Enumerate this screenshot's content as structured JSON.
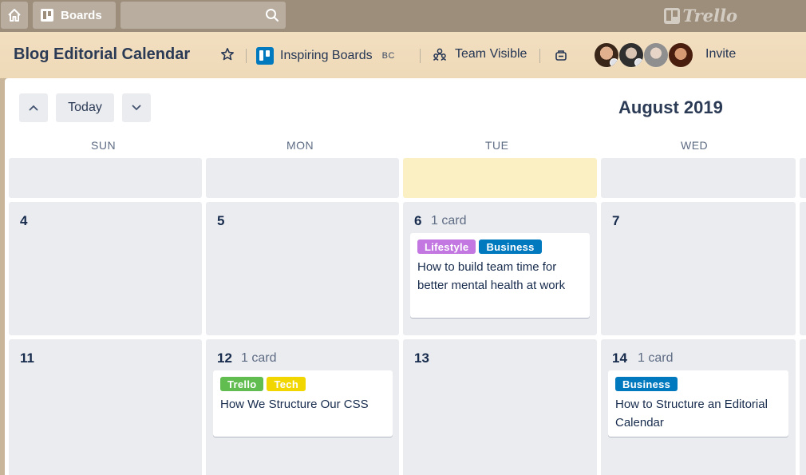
{
  "topbar": {
    "boards_label": "Boards",
    "search_placeholder": "",
    "logo_text": "Trello"
  },
  "board": {
    "title": "Blog Editorial Calendar",
    "team_name": "Inspiring Boards",
    "team_badge": "BC",
    "visibility": "Team Visible",
    "invite_label": "Invite",
    "members": [
      "member-1",
      "member-2",
      "member-3",
      "member-4"
    ]
  },
  "calendar": {
    "today_label": "Today",
    "month_title": "August 2019",
    "weekdays": [
      "SUN",
      "MON",
      "TUE",
      "WED"
    ],
    "rows": [
      {
        "cells": [
          {
            "day": "",
            "count": ""
          },
          {
            "day": "",
            "count": ""
          },
          {
            "day": "",
            "count": "",
            "today": true
          },
          {
            "day": "",
            "count": ""
          }
        ]
      },
      {
        "cells": [
          {
            "day": "4",
            "count": ""
          },
          {
            "day": "5",
            "count": ""
          },
          {
            "day": "6",
            "count": "1 card",
            "card": {
              "labels": [
                {
                  "text": "Lifestyle",
                  "color": "#c377e0"
                },
                {
                  "text": "Business",
                  "color": "#0079bf"
                }
              ],
              "title": "How to build team time for better mental health at work"
            }
          },
          {
            "day": "7",
            "count": ""
          }
        ]
      },
      {
        "cells": [
          {
            "day": "11",
            "count": ""
          },
          {
            "day": "12",
            "count": "1 card",
            "card": {
              "labels": [
                {
                  "text": "Trello",
                  "color": "#61bd4f"
                },
                {
                  "text": "Tech",
                  "color": "#f2d600"
                }
              ],
              "title": "How We Structure Our CSS"
            }
          },
          {
            "day": "13",
            "count": ""
          },
          {
            "day": "14",
            "count": "1 card",
            "card": {
              "labels": [
                {
                  "text": "Business",
                  "color": "#0079bf"
                }
              ],
              "title": "How to Structure an Editorial Calendar"
            }
          }
        ]
      }
    ]
  },
  "colors": {
    "topbar": "#9d8e7b",
    "header": "#f2dfc0",
    "today_cell": "#faf0c4",
    "cell": "#ebecf0"
  }
}
